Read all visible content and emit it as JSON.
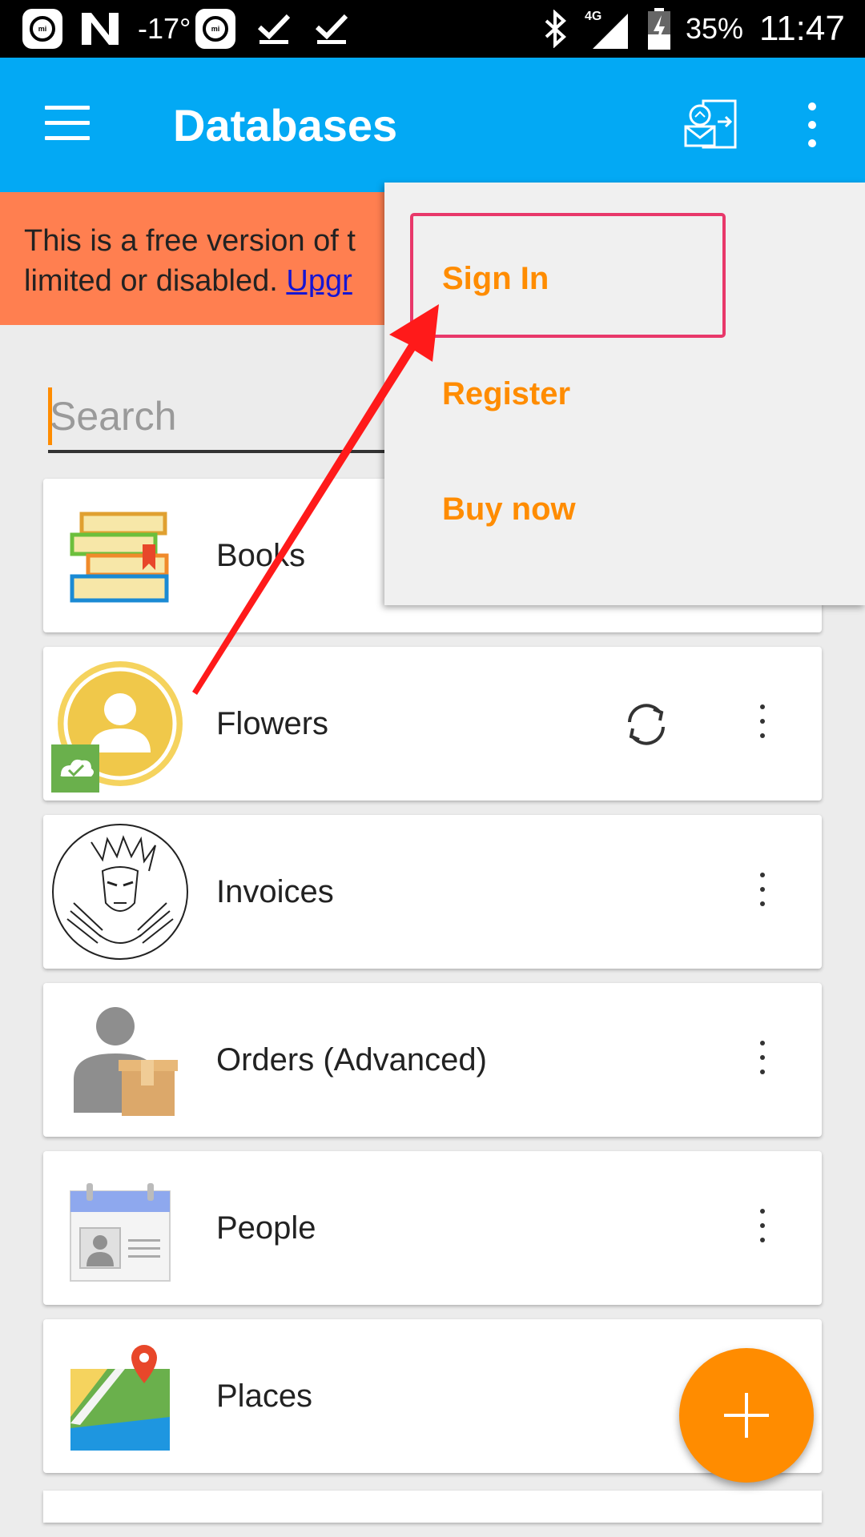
{
  "status_bar": {
    "temperature": "-17°",
    "network": "4G",
    "battery": "35%",
    "time": "11:47",
    "icons": [
      "mi-icon",
      "n-icon",
      "mi-icon",
      "download-done-icon",
      "download-done-icon",
      "bluetooth-icon",
      "signal-icon",
      "battery-charging-icon"
    ]
  },
  "app_bar": {
    "title": "Databases",
    "icons": [
      "hamburger-menu-icon",
      "sync-account-icon",
      "overflow-menu-icon"
    ]
  },
  "banner": {
    "text_line1": "This is a free version of t",
    "text_line2": "limited or disabled. ",
    "link_text": "Upgr",
    "color": "#ff7f50"
  },
  "search": {
    "placeholder": "Search",
    "value": ""
  },
  "databases": [
    {
      "name": "Books",
      "icon": "books-icon",
      "sync": false
    },
    {
      "name": "Flowers",
      "icon": "user-cloud-icon",
      "sync": true
    },
    {
      "name": "Invoices",
      "icon": "wolverine-sketch-icon",
      "sync": false
    },
    {
      "name": "Orders (Advanced)",
      "icon": "person-box-icon",
      "sync": false
    },
    {
      "name": "People",
      "icon": "id-card-icon",
      "sync": false
    },
    {
      "name": "Places",
      "icon": "map-pin-icon",
      "sync": false
    }
  ],
  "menu": {
    "items": [
      "Sign In",
      "Register",
      "Buy now"
    ],
    "highlighted": "Sign In",
    "item_color": "#ff8c00"
  },
  "colors": {
    "app_bar": "#03a9f4",
    "accent": "#ff8c00",
    "highlight_box": "#e8386a",
    "arrow": "#ff1a1a"
  },
  "fab": {
    "icon": "plus-icon"
  }
}
